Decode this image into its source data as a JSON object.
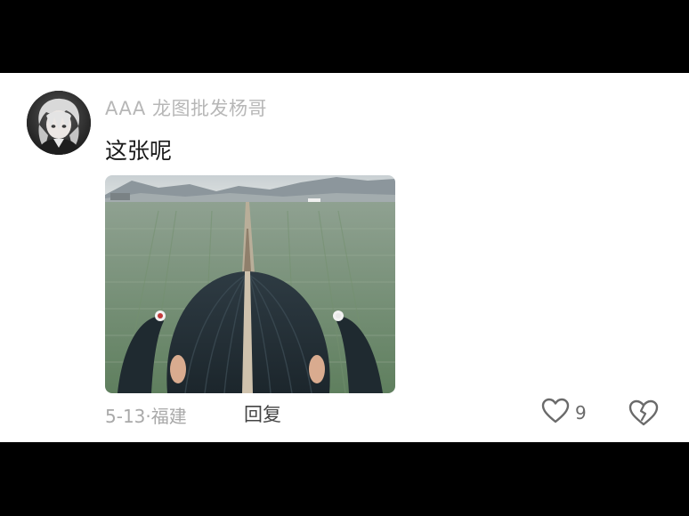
{
  "comment": {
    "username": "AAA 龙图批发杨哥",
    "text": "这张呢",
    "date": "5-13",
    "separator": "·",
    "location": "福建",
    "reply_label": "回复",
    "like_count": "9",
    "icons": {
      "like": "heart-outline-icon",
      "dislike": "broken-heart-icon"
    },
    "colors": {
      "background": "#ffffff",
      "username": "#b7b7b7",
      "meta": "#a9a9a9",
      "text": "#1a1a1a"
    }
  }
}
